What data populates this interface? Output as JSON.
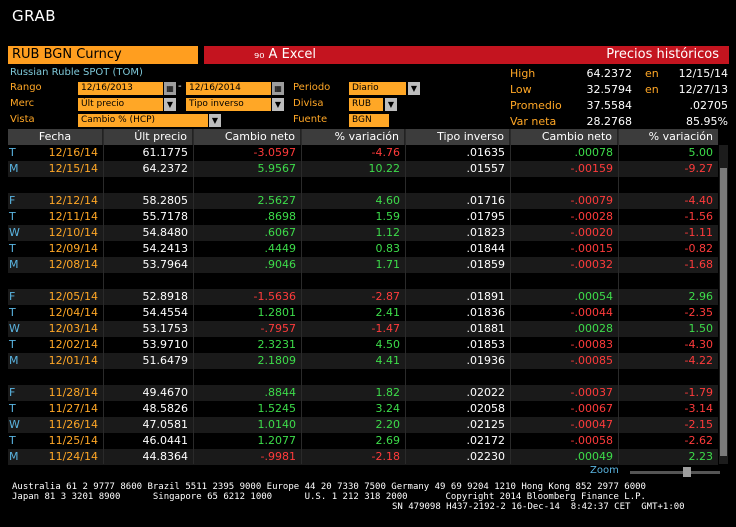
{
  "app": {
    "title": "GRAB"
  },
  "header": {
    "security": "RUB BGN Curncy",
    "excel_label": "₉₀ A Excel",
    "hist_label": "Precios históricos",
    "subtitle": "Russian Ruble SPOT (TOM)"
  },
  "form": {
    "rango_label": "Rango",
    "start_date": "12/16/2013",
    "end_date": "12/16/2014",
    "merc_label": "Merc",
    "merc_value": "Últ precio",
    "merc2_value": "Tipo inverso",
    "vista_label": "Vista",
    "vista_value": "Cambio % (HCP)",
    "periodo_label": "Periodo",
    "periodo_value": "Diario",
    "divisa_label": "Divisa",
    "divisa_value": "RUB",
    "fuente_label": "Fuente",
    "fuente_value": "BGN"
  },
  "stats": {
    "high_label": "High",
    "high_value": "64.2372",
    "high_en": "en",
    "high_date": "12/15/14",
    "low_label": "Low",
    "low_value": "32.5794",
    "low_en": "en",
    "low_date": "12/27/13",
    "prom_label": "Promedio",
    "prom_value": "37.5584",
    "prom_extra": ".02705",
    "var_label": "Var neta",
    "var_value": "28.2768",
    "var_extra": "85.95%"
  },
  "table": {
    "columns": [
      "Fecha",
      "Últ precio",
      "Cambio neto",
      "% variación",
      "Tipo inverso",
      "Cambio neto",
      "% variación"
    ],
    "rows": [
      {
        "day": "T",
        "date": "12/16/14",
        "price": "61.1775",
        "chg": "-3.0597",
        "pct": "-4.76",
        "inv": ".01635",
        "ichg": ".00078",
        "ipct": "5.00"
      },
      {
        "day": "M",
        "date": "12/15/14",
        "price": "64.2372",
        "chg": "5.9567",
        "pct": "10.22",
        "inv": ".01557",
        "ichg": "-.00159",
        "ipct": "-9.27"
      },
      {
        "blank": true
      },
      {
        "day": "F",
        "date": "12/12/14",
        "price": "58.2805",
        "chg": "2.5627",
        "pct": "4.60",
        "inv": ".01716",
        "ichg": "-.00079",
        "ipct": "-4.40"
      },
      {
        "day": "T",
        "date": "12/11/14",
        "price": "55.7178",
        "chg": ".8698",
        "pct": "1.59",
        "inv": ".01795",
        "ichg": "-.00028",
        "ipct": "-1.56"
      },
      {
        "day": "W",
        "date": "12/10/14",
        "price": "54.8480",
        "chg": ".6067",
        "pct": "1.12",
        "inv": ".01823",
        "ichg": "-.00020",
        "ipct": "-1.11"
      },
      {
        "day": "T",
        "date": "12/09/14",
        "price": "54.2413",
        "chg": ".4449",
        "pct": "0.83",
        "inv": ".01844",
        "ichg": "-.00015",
        "ipct": "-0.82"
      },
      {
        "day": "M",
        "date": "12/08/14",
        "price": "53.7964",
        "chg": ".9046",
        "pct": "1.71",
        "inv": ".01859",
        "ichg": "-.00032",
        "ipct": "-1.68"
      },
      {
        "blank": true
      },
      {
        "day": "F",
        "date": "12/05/14",
        "price": "52.8918",
        "chg": "-1.5636",
        "pct": "-2.87",
        "inv": ".01891",
        "ichg": ".00054",
        "ipct": "2.96"
      },
      {
        "day": "T",
        "date": "12/04/14",
        "price": "54.4554",
        "chg": "1.2801",
        "pct": "2.41",
        "inv": ".01836",
        "ichg": "-.00044",
        "ipct": "-2.35"
      },
      {
        "day": "W",
        "date": "12/03/14",
        "price": "53.1753",
        "chg": "-.7957",
        "pct": "-1.47",
        "inv": ".01881",
        "ichg": ".00028",
        "ipct": "1.50"
      },
      {
        "day": "T",
        "date": "12/02/14",
        "price": "53.9710",
        "chg": "2.3231",
        "pct": "4.50",
        "inv": ".01853",
        "ichg": "-.00083",
        "ipct": "-4.30"
      },
      {
        "day": "M",
        "date": "12/01/14",
        "price": "51.6479",
        "chg": "2.1809",
        "pct": "4.41",
        "inv": ".01936",
        "ichg": "-.00085",
        "ipct": "-4.22"
      },
      {
        "blank": true
      },
      {
        "day": "F",
        "date": "11/28/14",
        "price": "49.4670",
        "chg": ".8844",
        "pct": "1.82",
        "inv": ".02022",
        "ichg": "-.00037",
        "ipct": "-1.79"
      },
      {
        "day": "T",
        "date": "11/27/14",
        "price": "48.5826",
        "chg": "1.5245",
        "pct": "3.24",
        "inv": ".02058",
        "ichg": "-.00067",
        "ipct": "-3.14"
      },
      {
        "day": "W",
        "date": "11/26/14",
        "price": "47.0581",
        "chg": "1.0140",
        "pct": "2.20",
        "inv": ".02125",
        "ichg": "-.00047",
        "ipct": "-2.15"
      },
      {
        "day": "T",
        "date": "11/25/14",
        "price": "46.0441",
        "chg": "1.2077",
        "pct": "2.69",
        "inv": ".02172",
        "ichg": "-.00058",
        "ipct": "-2.62"
      },
      {
        "day": "M",
        "date": "11/24/14",
        "price": "44.8364",
        "chg": "-.9981",
        "pct": "-2.18",
        "inv": ".02230",
        "ichg": ".00049",
        "ipct": "2.23"
      }
    ]
  },
  "zoom": {
    "label": "Zoom"
  },
  "footer": {
    "line1": "Australia 61 2 9777 8600 Brazil 5511 2395 9000 Europe 44 20 7330 7500 Germany 49 69 9204 1210 Hong Kong 852 2977 6000",
    "line2": "Japan 81 3 3201 8900      Singapore 65 6212 1000      U.S. 1 212 318 2000       Copyright 2014 Bloomberg Finance L.P.",
    "line3": "SN 479098 H437-2192-2 16-Dec-14  8:42:37 CET  GMT+1:00"
  },
  "colors": {
    "orange": "#ffa726",
    "red_bar": "#c4141f",
    "green": "#3ddc4a",
    "red": "#ff3b3b",
    "blue": "#5ab4e0"
  },
  "icons": [
    "calendar-icon",
    "dropdown-arrow-icon",
    "excel-icon"
  ]
}
